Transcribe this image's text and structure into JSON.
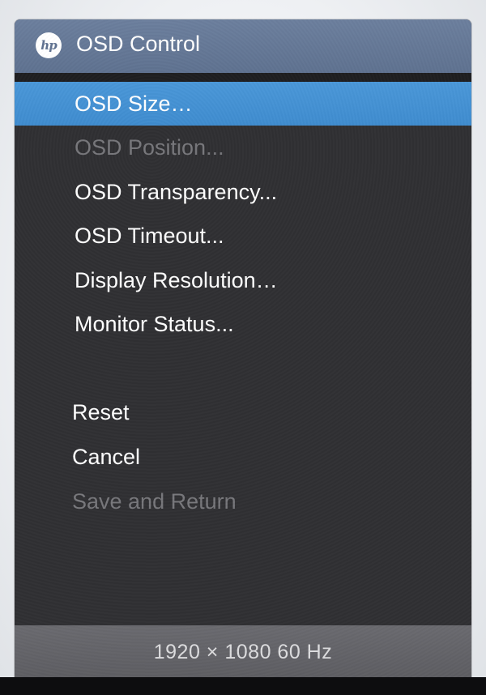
{
  "header": {
    "logo_text": "hp",
    "title": "OSD Control"
  },
  "menu": {
    "items": [
      {
        "label": "OSD Size…",
        "state": "selected"
      },
      {
        "label": "OSD Position...",
        "state": "disabled"
      },
      {
        "label": "OSD Transparency...",
        "state": "enabled"
      },
      {
        "label": "OSD Timeout...",
        "state": "enabled"
      },
      {
        "label": "Display Resolution…",
        "state": "enabled"
      },
      {
        "label": "Monitor Status...",
        "state": "enabled"
      }
    ],
    "actions": [
      {
        "label": "Reset",
        "state": "enabled"
      },
      {
        "label": "Cancel",
        "state": "enabled"
      },
      {
        "label": "Save and Return",
        "state": "disabled"
      }
    ]
  },
  "status": {
    "resolution_text": "1920 × 1080  60 Hz"
  },
  "colors": {
    "header": "#5f7290",
    "selected": "#4592d3",
    "panel": "#303033",
    "disabled_text": "#77777b",
    "status_bar": "#616166"
  }
}
